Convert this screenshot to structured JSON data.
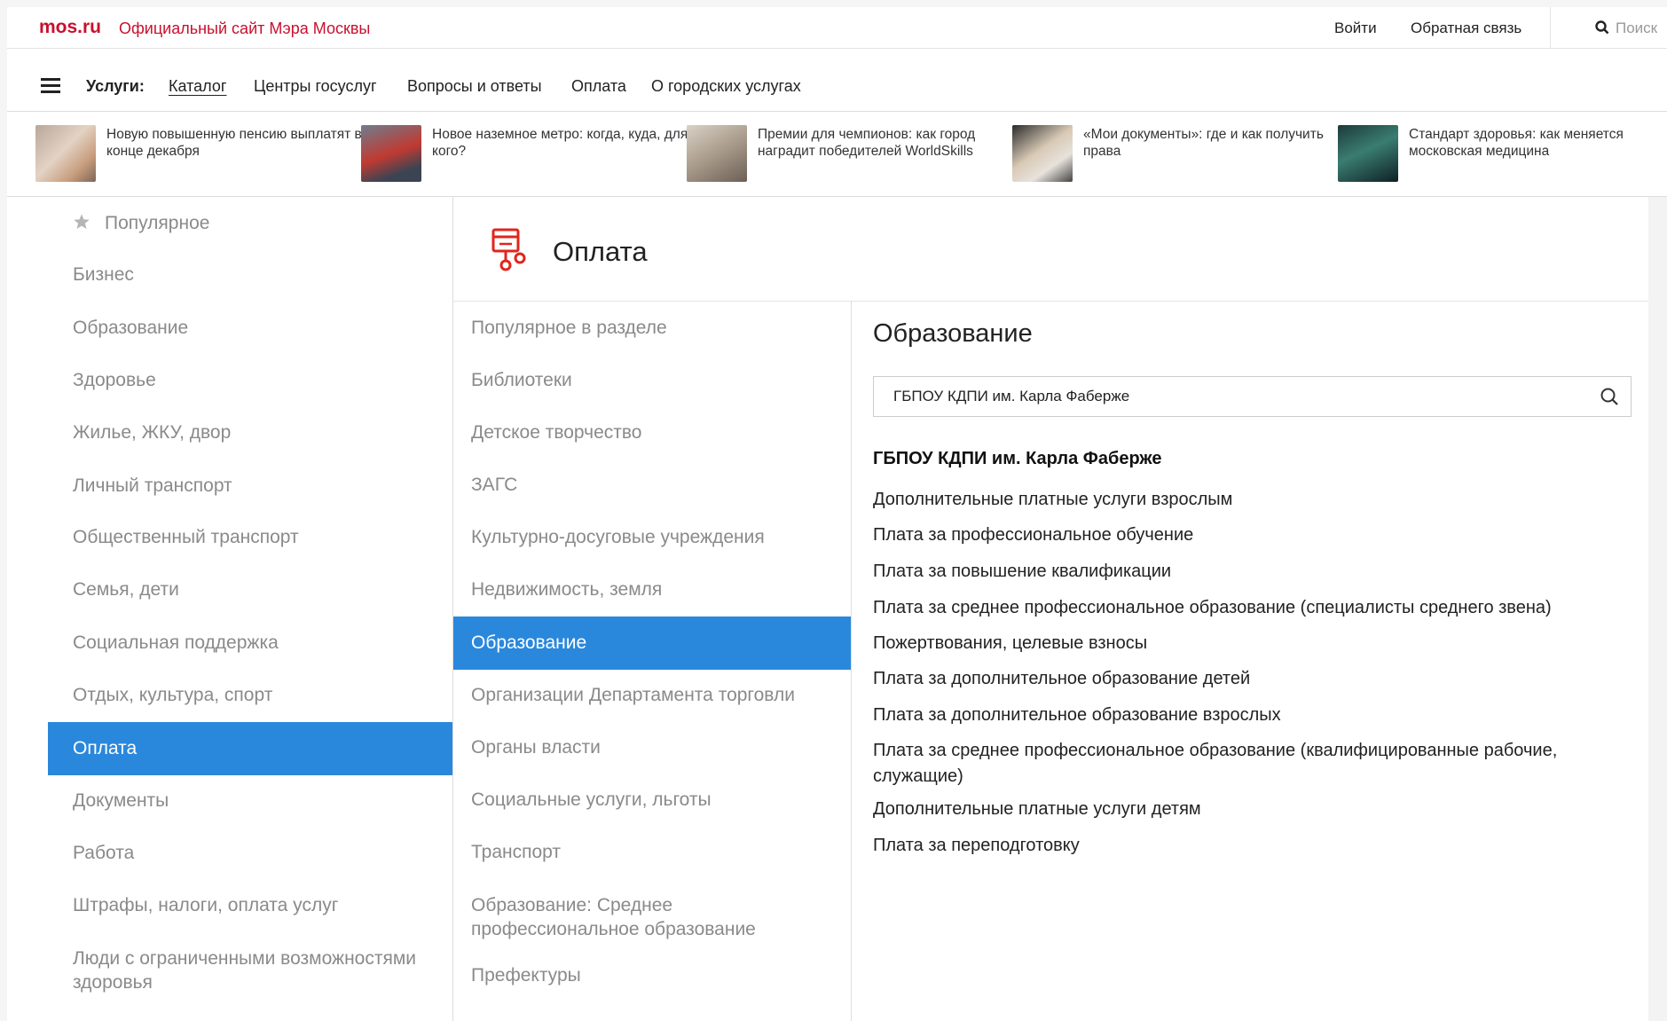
{
  "header": {
    "logo": "mos.ru",
    "site_title": "Официальный сайт Мэра Москвы",
    "login": "Войти",
    "feedback": "Обратная связь",
    "search_label": "Поиск"
  },
  "nav": {
    "title": "Услуги:",
    "links": [
      "Каталог",
      "Центры госуслуг",
      "Вопросы и ответы",
      "Оплата",
      "О городских услугах"
    ],
    "active": "Каталог"
  },
  "news": [
    {
      "text": "Новую повышенную пенсию выплатят в конце декабря"
    },
    {
      "text": "Новое наземное метро: когда, куда, для кого?"
    },
    {
      "text": "Премии для чемпионов: как город наградит победителей WorldSkills"
    },
    {
      "text": "«Мои документы»: где и как получить права"
    },
    {
      "text": "Стандарт здоровья: как меняется московская медицина"
    }
  ],
  "categories": {
    "items": [
      "Популярное",
      "Бизнес",
      "Образование",
      "Здоровье",
      "Жилье, ЖКУ, двор",
      "Личный транспорт",
      "Общественный транспорт",
      "Семья, дети",
      "Социальная поддержка",
      "Отдых, культура, спорт",
      "Оплата",
      "Документы",
      "Работа",
      "Штрафы, налоги, оплата услуг",
      "Люди с ограниченными возможностями здоровья"
    ],
    "active": "Оплата"
  },
  "section": {
    "title": "Оплата",
    "subitems": [
      "Популярное в разделе",
      "Библиотеки",
      "Детское творчество",
      "ЗАГС",
      "Культурно-досуговые учреждения",
      "Недвижимость, земля",
      "Образование",
      "Организации Департамента торговли",
      "Органы власти",
      "Социальные услуги, льготы",
      "Транспорт",
      "Образование: Среднее профессиональное образование",
      "Префектуры"
    ],
    "active_subitem": "Образование"
  },
  "detail": {
    "title": "Образование",
    "search_value": "ГБПОУ КДПИ им. Карла Фаберже",
    "result_heading": "ГБПОУ КДПИ им. Карла Фаберже",
    "results": [
      "Дополнительные платные услуги взрослым",
      "Плата за профессиональное обучение",
      "Плата за повышение квалификации",
      "Плата за среднее профессиональное образование (специалисты среднего звена)",
      "Пожертвования, целевые взносы",
      "Плата за дополнительное образование детей",
      "Плата за дополнительное образование взрослых",
      "Плата за среднее профессиональное образование (квалифицированные рабочие, служащие)",
      "Дополнительные платные услуги детям",
      "Плата за переподготовку"
    ]
  },
  "colors": {
    "brand": "#c8102e",
    "active_bg": "#2a88dc",
    "muted_text": "#8a8a8a"
  },
  "icons": [
    "menu-icon",
    "search-icon",
    "star-icon",
    "wallet-icon"
  ]
}
